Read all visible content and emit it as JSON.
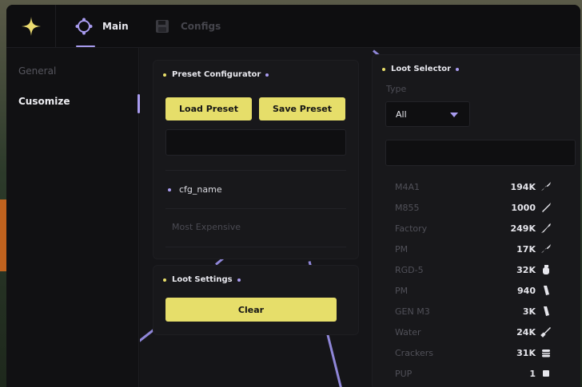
{
  "header": {
    "logo_icon": "sparkle-icon",
    "tabs": [
      {
        "label": "Main",
        "icon": "crosshair-icon",
        "active": true
      },
      {
        "label": "Configs",
        "icon": "floppy-disk-icon",
        "active": false
      }
    ]
  },
  "sidebar": {
    "items": [
      {
        "label": "General",
        "active": false
      },
      {
        "label": "Cusomize",
        "active": true
      }
    ]
  },
  "preset_configurator": {
    "title": "Preset Configurator",
    "load_label": "Load Preset",
    "save_label": "Save Preset",
    "name_input_value": "",
    "configs": [
      {
        "label": "cfg_name",
        "selected": true
      },
      {
        "label": "Most Expensive",
        "selected": false
      }
    ]
  },
  "loot_settings": {
    "title": "Loot Settings",
    "clear_label": "Clear"
  },
  "loot_selector": {
    "title": "Loot Selector",
    "type_label": "Type",
    "type_value": "All",
    "search_value": "",
    "items": [
      {
        "name": "M4A1",
        "price": "194K",
        "icon": "rifle-icon"
      },
      {
        "name": "M855",
        "price": "1000",
        "icon": "bullet-icon"
      },
      {
        "name": "Factory",
        "price": "249K",
        "icon": "rifle-icon"
      },
      {
        "name": "PM",
        "price": "17K",
        "icon": "pistol-icon"
      },
      {
        "name": "RGD-5",
        "price": "32K",
        "icon": "grenade-icon"
      },
      {
        "name": "PM",
        "price": "940",
        "icon": "magazine-icon"
      },
      {
        "name": "GEN M3",
        "price": "3K",
        "icon": "magazine-icon"
      },
      {
        "name": "Water",
        "price": "24K",
        "icon": "bottle-icon"
      },
      {
        "name": "Crackers",
        "price": "31K",
        "icon": "food-icon"
      },
      {
        "name": "PUP",
        "price": "1",
        "icon": "item-icon"
      }
    ]
  },
  "colors": {
    "accent_yellow": "#e6de6a",
    "accent_purple": "#a99cf0",
    "background": "#121214"
  }
}
